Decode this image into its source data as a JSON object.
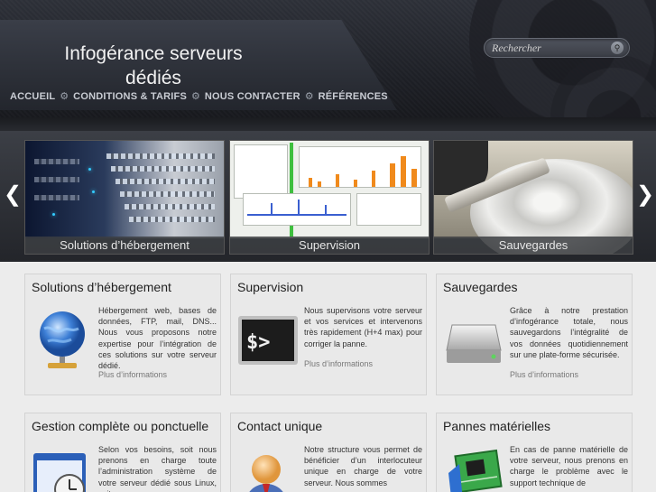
{
  "header": {
    "title": "Infogérance serveurs dédiés",
    "search_placeholder": "Rechercher",
    "nav": [
      {
        "label": "ACCUEIL"
      },
      {
        "label": "CONDITIONS & TARIFS"
      },
      {
        "label": "NOUS CONTACTER"
      },
      {
        "label": "RÉFÉRENCES"
      }
    ]
  },
  "slider": {
    "slides": [
      {
        "caption": "Solutions d’hébergement"
      },
      {
        "caption": "Supervision"
      },
      {
        "caption": "Sauvegardes"
      }
    ]
  },
  "cards": [
    {
      "title": "Solutions d’hébergement",
      "body": "Hébergement web, bases de données, FTP, mail, DNS... Nous vous proposons notre expertise pour l’intégration de ces solutions sur votre serveur dédié.",
      "more": "Plus d’informations",
      "icon": "network-globe-icon"
    },
    {
      "title": "Supervision",
      "body": "Nous supervisons votre serveur et vos services et intervenons très rapidement (H+4 max) pour corriger la panne.",
      "more": "Plus d’informations",
      "icon": "terminal-icon"
    },
    {
      "title": "Sauvegardes",
      "body": "Grâce à notre prestation d’infogérance totale, nous sauvegardons l’intégralité de vos données quotidiennement sur une plate-forme sécurisée.",
      "more": "Plus d’informations",
      "icon": "hard-drive-icon"
    },
    {
      "title": "Gestion complète ou ponctuelle",
      "body": "Selon vos besoins, soit nous prenons en charge toute l’administration système de votre serveur dédié sous Linux, soit",
      "icon": "clock-window-icon"
    },
    {
      "title": "Contact unique",
      "body": "Notre structure vous permet de bénéficier d’un interlocuteur unique en charge de votre serveur. Nous sommes",
      "icon": "user-icon"
    },
    {
      "title": "Pannes matérielles",
      "body": "En cas de panne matérielle de votre serveur, nous prenons en charge le problème avec le support technique de",
      "icon": "circuit-board-icon"
    }
  ]
}
